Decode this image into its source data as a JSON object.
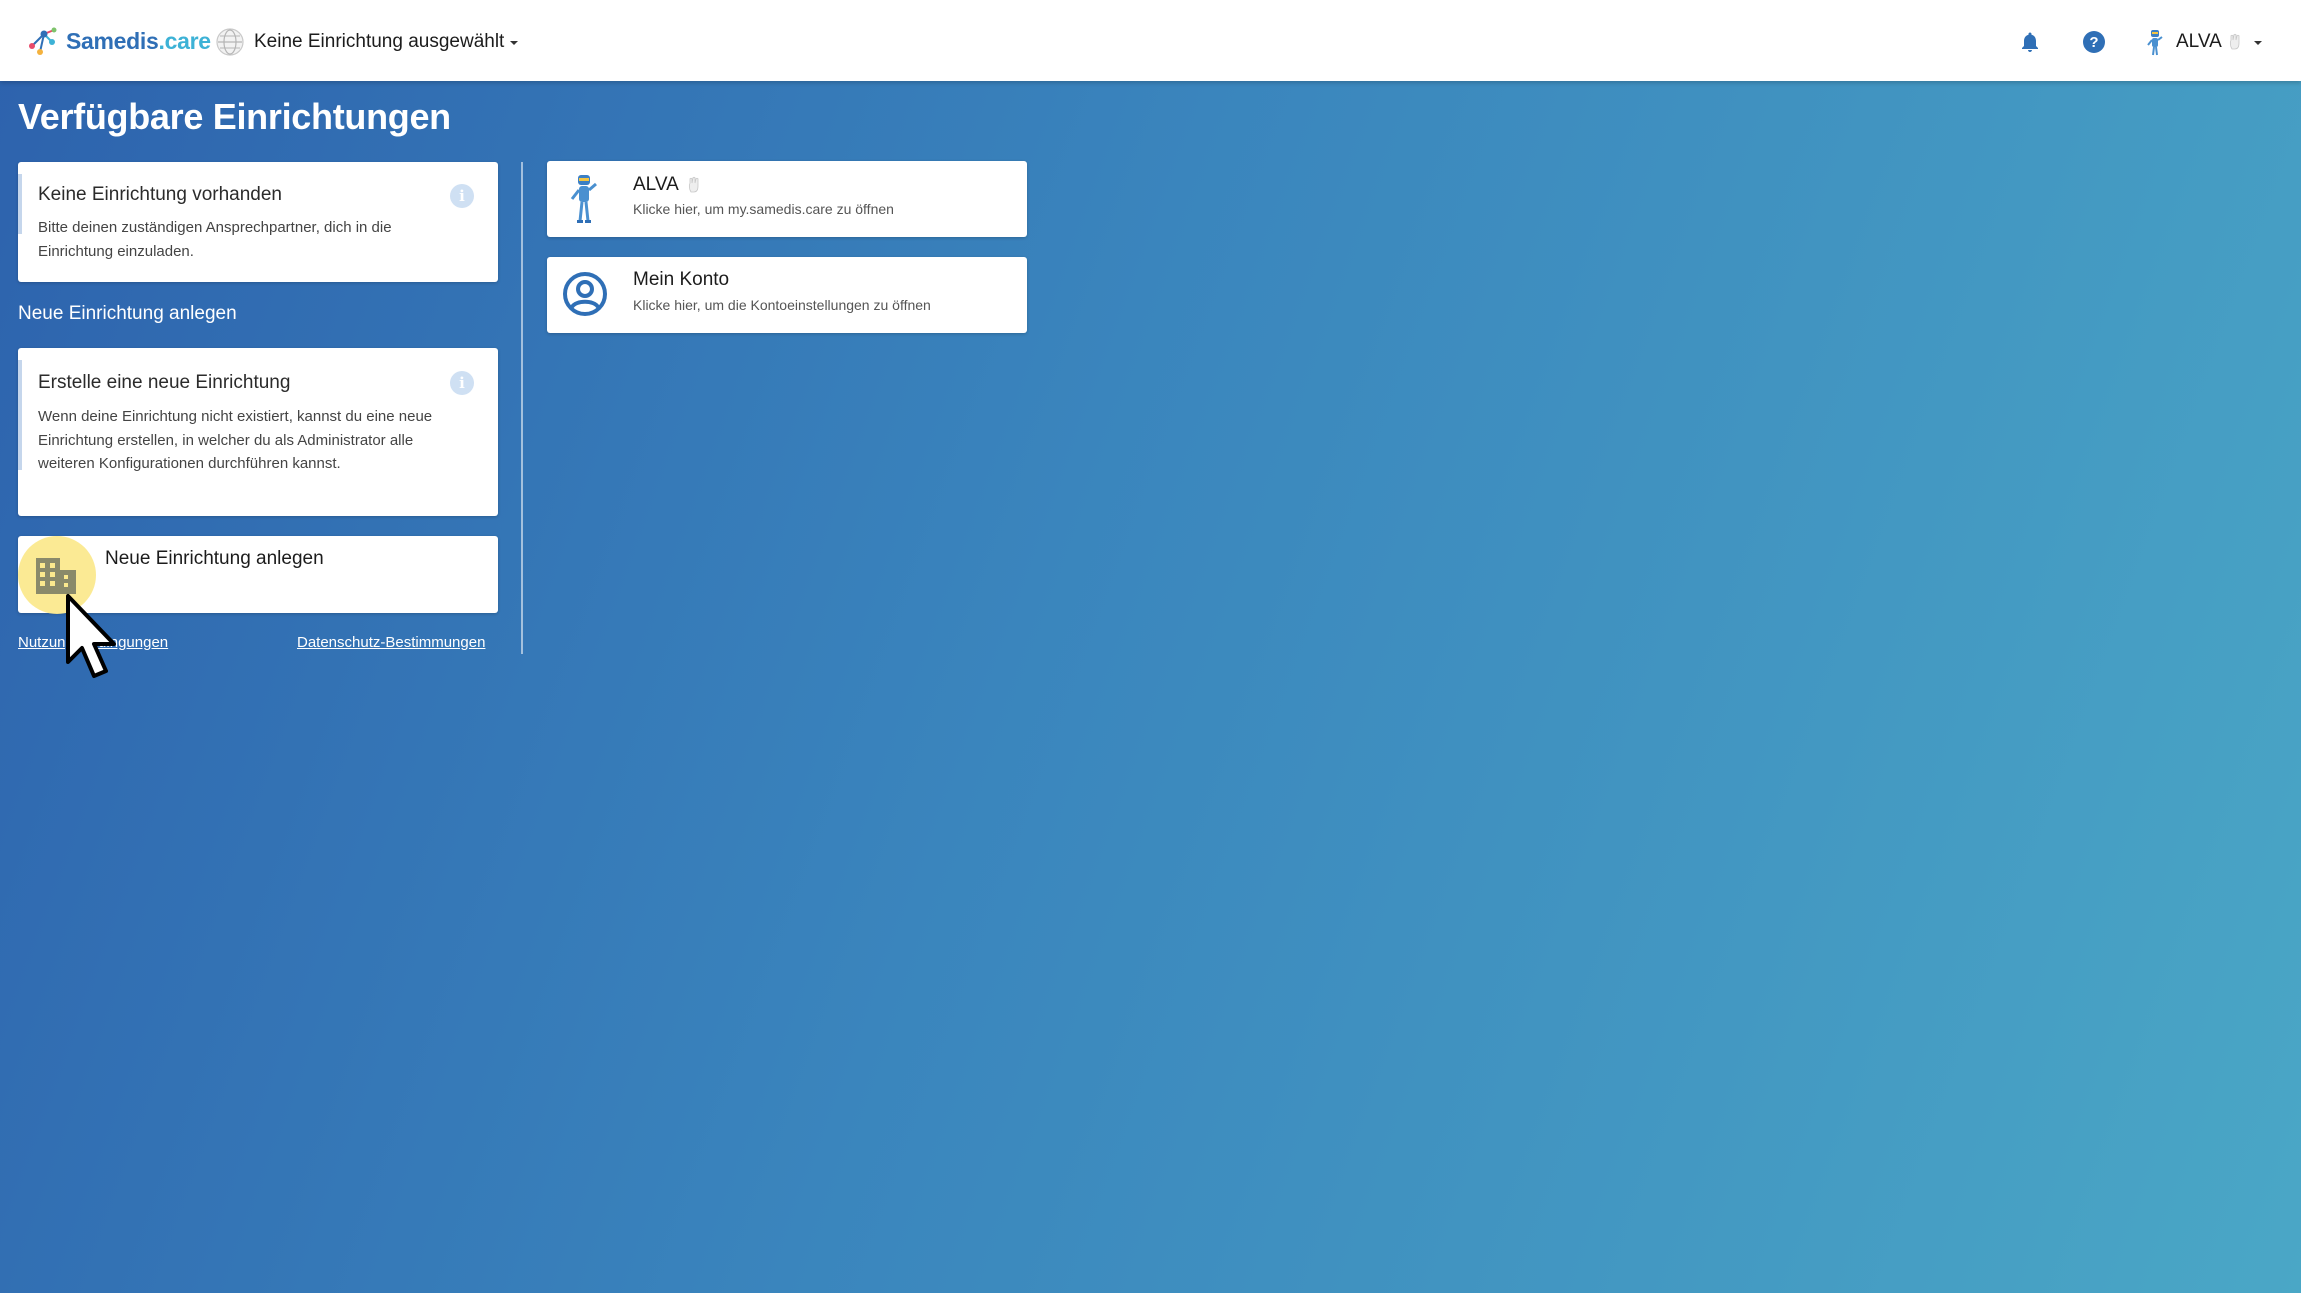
{
  "header": {
    "logo_main": "Samedis",
    "logo_tld": ".care",
    "facility_selector": "Keine Einrichtung ausgewählt",
    "user_name": "ALVA"
  },
  "page": {
    "title": "Verfügbare Einrichtungen"
  },
  "no_facility_card": {
    "title": "Keine Einrichtung vorhanden",
    "body": "Bitte deinen zuständigen Ansprechpartner, dich in die Einrichtung einzuladen."
  },
  "new_facility_section": {
    "heading": "Neue Einrichtung anlegen"
  },
  "create_card": {
    "title": "Erstelle eine neue Einrichtung",
    "body": "Wenn deine Einrichtung nicht existiert, kannst du eine neue Einrichtung erstellen, in welcher du als Administrator alle weiteren Konfigurationen durchführen kannst."
  },
  "create_button": {
    "label": "Neue Einrichtung anlegen",
    "icon": "building-icon"
  },
  "footer_links": {
    "terms": "Nutzungsbedingungen",
    "privacy": "Datenschutz-Bestimmungen"
  },
  "app_cards": [
    {
      "title": "ALVA",
      "subtitle": "Klicke hier, um my.samedis.care zu öffnen",
      "icon": "alva-robot-icon"
    },
    {
      "title": "Mein Konto",
      "subtitle": "Klicke hier, um die Kontoeinstellungen zu öffnen",
      "icon": "account-circle-icon"
    }
  ],
  "colors": {
    "brand_blue": "#2f6fb6",
    "brand_cyan": "#3db2d6",
    "background_start": "#2d62ad",
    "background_end": "#4aa7c6"
  }
}
